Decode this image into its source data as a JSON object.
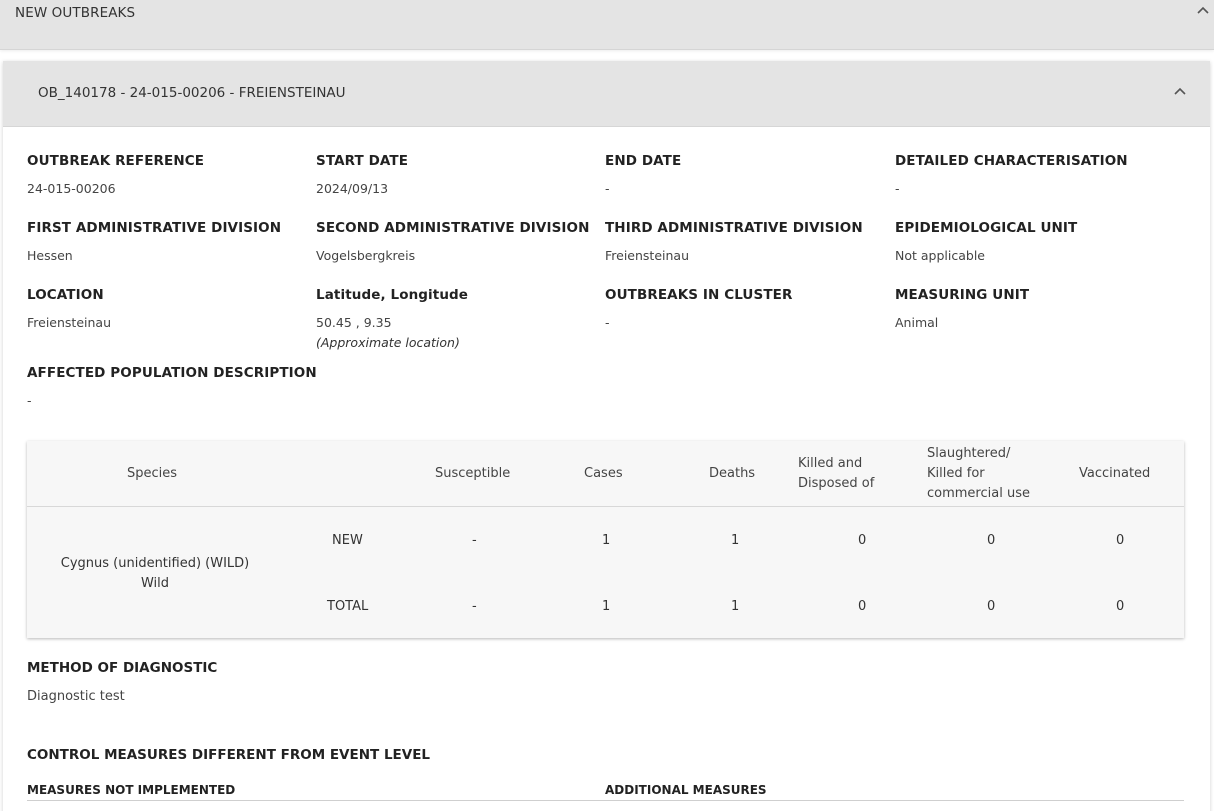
{
  "top_panel": {
    "title": "NEW OUTBREAKS",
    "icon": "chevron-up-icon"
  },
  "outbreak": {
    "title": "OB_140178 - 24-015-00206 - FREIENSTEINAU",
    "icon": "chevron-up-icon",
    "fields": {
      "outbreak_reference": {
        "label": "OUTBREAK REFERENCE",
        "value": "24-015-00206"
      },
      "start_date": {
        "label": "START DATE",
        "value": "2024/09/13"
      },
      "end_date": {
        "label": "END DATE",
        "value": "-"
      },
      "detailed_characterisation": {
        "label": "DETAILED CHARACTERISATION",
        "value": "-"
      },
      "first_admin": {
        "label": "FIRST ADMINISTRATIVE DIVISION",
        "value": "Hessen"
      },
      "second_admin": {
        "label": "SECOND ADMINISTRATIVE DIVISION",
        "value": "Vogelsbergkreis"
      },
      "third_admin": {
        "label": "THIRD ADMINISTRATIVE DIVISION",
        "value": "Freiensteinau"
      },
      "epi_unit": {
        "label": "EPIDEMIOLOGICAL UNIT",
        "value": "Not applicable"
      },
      "location": {
        "label": "LOCATION",
        "value": "Freiensteinau"
      },
      "lat_long": {
        "label": "Latitude, Longitude",
        "value": "50.45 , 9.35",
        "note": "(Approximate location)"
      },
      "outbreaks_in_cluster": {
        "label": "OUTBREAKS IN CLUSTER",
        "value": "-"
      },
      "measuring_unit": {
        "label": "MEASURING UNIT",
        "value": "Animal"
      },
      "affected_population": {
        "label": "AFFECTED POPULATION DESCRIPTION",
        "value": "-"
      }
    },
    "table": {
      "headers": {
        "species": "Species",
        "susceptible": "Susceptible",
        "cases": "Cases",
        "deaths": "Deaths",
        "killed_line1": "Killed and",
        "killed_line2": "Disposed of",
        "slaughtered_line1": "Slaughtered/",
        "slaughtered_line2": "Killed for",
        "slaughtered_line3": "commercial use",
        "vaccinated": "Vaccinated"
      },
      "species_line1": "Cygnus (unidentified) (WILD)",
      "species_line2": "Wild",
      "rows": [
        {
          "label": "NEW",
          "susceptible": "-",
          "cases": "1",
          "deaths": "1",
          "killed": "0",
          "slaughtered": "0",
          "vaccinated": "0"
        },
        {
          "label": "TOTAL",
          "susceptible": "-",
          "cases": "1",
          "deaths": "1",
          "killed": "0",
          "slaughtered": "0",
          "vaccinated": "0"
        }
      ]
    },
    "method_of_diagnostic": {
      "label": "METHOD OF DIAGNOSTIC",
      "value": "Diagnostic test"
    },
    "control_measures": {
      "title": "CONTROL MEASURES DIFFERENT FROM EVENT LEVEL",
      "not_implemented": "MEASURES NOT IMPLEMENTED",
      "additional": "ADDITIONAL MEASURES"
    }
  }
}
